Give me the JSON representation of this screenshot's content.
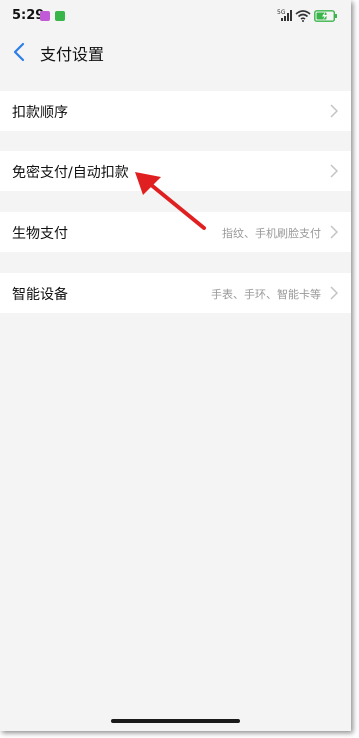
{
  "status_bar": {
    "time": "5:29",
    "signal_text": "5G",
    "icons": [
      "notification-app-icon",
      "notification-app-icon",
      "signal-icon",
      "wifi-icon",
      "battery-charging-icon"
    ]
  },
  "header": {
    "back_icon": "chevron-left-icon",
    "title": "支付设置"
  },
  "settings": {
    "items": [
      {
        "label": "扣款顺序",
        "value": ""
      },
      {
        "label": "免密支付/自动扣款",
        "value": ""
      },
      {
        "label": "生物支付",
        "value": "指纹、手机刷脸支付"
      },
      {
        "label": "智能设备",
        "value": "手表、手环、智能卡等"
      }
    ],
    "chevron_icon": "chevron-right-icon"
  },
  "annotation": {
    "icon": "red-arrow-icon",
    "color": "#e02020"
  },
  "colors": {
    "accent": "#2b7de9",
    "background": "#f4f4f4",
    "row": "#ffffff",
    "secondary_text": "#999999"
  }
}
